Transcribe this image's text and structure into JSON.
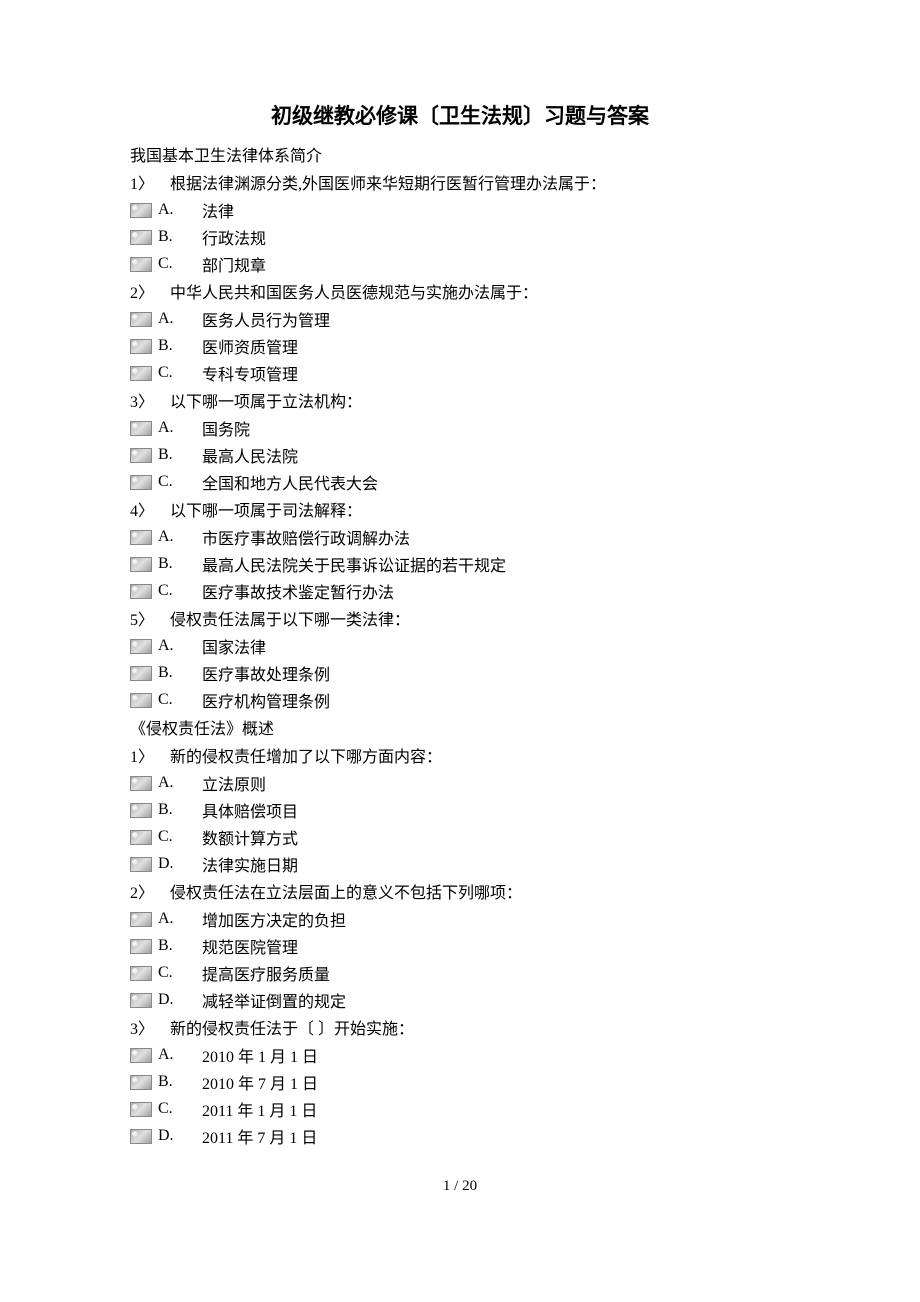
{
  "title": "初级继教必修课〔卫生法规〕习题与答案",
  "sections": [
    {
      "header": "我国基本卫生法律体系简介",
      "questions": [
        {
          "num": "1〉",
          "text": "根据法律渊源分类,外国医师来华短期行医暂行管理办法属于：",
          "opts": [
            {
              "label": "A.",
              "text": "法律"
            },
            {
              "label": "B.",
              "text": "行政法规"
            },
            {
              "label": "C.",
              "text": "部门规章"
            }
          ]
        },
        {
          "num": "2〉",
          "text": "中华人民共和国医务人员医德规范与实施办法属于：",
          "opts": [
            {
              "label": "A.",
              "text": "医务人员行为管理"
            },
            {
              "label": "B.",
              "text": "医师资质管理"
            },
            {
              "label": "C.",
              "text": "专科专项管理"
            }
          ]
        },
        {
          "num": "3〉",
          "text": "以下哪一项属于立法机构：",
          "opts": [
            {
              "label": "A.",
              "text": "国务院"
            },
            {
              "label": "B.",
              "text": "最高人民法院"
            },
            {
              "label": "C.",
              "text": "全国和地方人民代表大会"
            }
          ]
        },
        {
          "num": "4〉",
          "text": "以下哪一项属于司法解释：",
          "opts": [
            {
              "label": "A.",
              "text": "市医疗事故赔偿行政调解办法"
            },
            {
              "label": "B.",
              "text": "最高人民法院关于民事诉讼证据的若干规定"
            },
            {
              "label": "C.",
              "text": "医疗事故技术鉴定暂行办法"
            }
          ]
        },
        {
          "num": "5〉",
          "text": "侵权责任法属于以下哪一类法律：",
          "opts": [
            {
              "label": "A.",
              "text": "国家法律"
            },
            {
              "label": "B.",
              "text": "医疗事故处理条例"
            },
            {
              "label": "C.",
              "text": "医疗机构管理条例"
            }
          ]
        }
      ]
    },
    {
      "header": "《侵权责任法》概述",
      "questions": [
        {
          "num": "1〉",
          "text": "新的侵权责任增加了以下哪方面内容：",
          "opts": [
            {
              "label": "A.",
              "text": "立法原则"
            },
            {
              "label": "B.",
              "text": "具体赔偿项目"
            },
            {
              "label": "C.",
              "text": "数额计算方式"
            },
            {
              "label": "D.",
              "text": "法律实施日期"
            }
          ]
        },
        {
          "num": "2〉",
          "text": "侵权责任法在立法层面上的意义不包括下列哪项：",
          "opts": [
            {
              "label": "A.",
              "text": "增加医方决定的负担"
            },
            {
              "label": "B.",
              "text": "规范医院管理"
            },
            {
              "label": "C.",
              "text": "提高医疗服务质量"
            },
            {
              "label": "D.",
              "text": "减轻举证倒置的规定"
            }
          ]
        },
        {
          "num": "3〉",
          "text": "新的侵权责任法于〔  〕开始实施：",
          "opts": [
            {
              "label": "A.",
              "text": "2010 年 1 月 1 日"
            },
            {
              "label": "B.",
              "text": "2010 年 7 月 1 日"
            },
            {
              "label": "C.",
              "text": "2011 年 1 月 1 日"
            },
            {
              "label": "D.",
              "text": "2011 年 7 月 1 日"
            }
          ]
        }
      ]
    }
  ],
  "pageNumber": "1 / 20"
}
